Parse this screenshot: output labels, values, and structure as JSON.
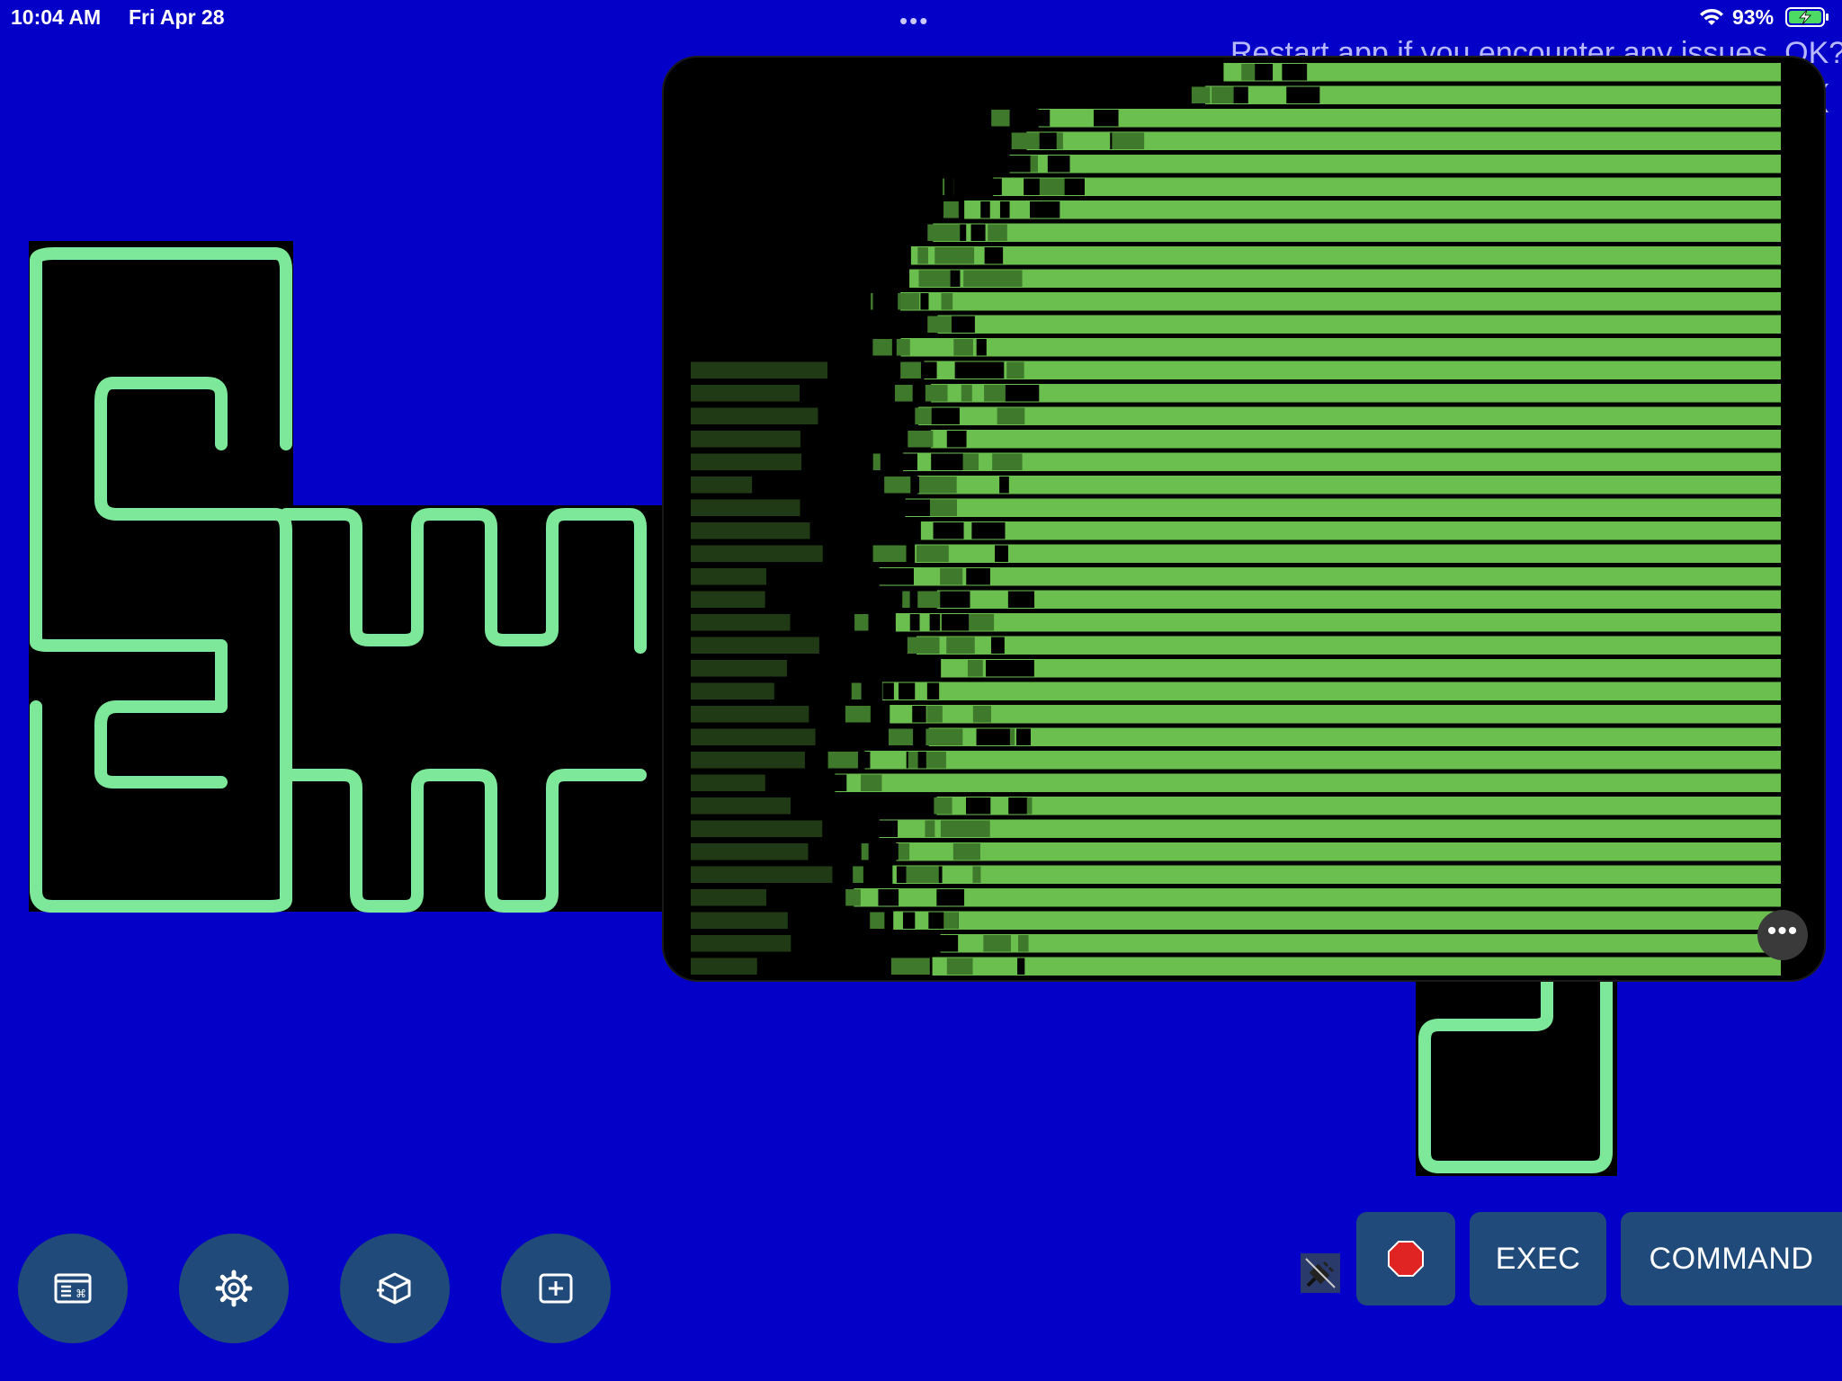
{
  "status_bar": {
    "time": "10:04 AM",
    "date": "Fri Apr 28",
    "multitask_dots": "•••",
    "battery_percent": "93%",
    "wifi_icon": "wifi-icon",
    "battery_icon": "battery-charging-icon"
  },
  "background": {
    "notice_line": "Restart app if you encounter any issues. OK?",
    "second_line": "(",
    "logo_color": "#7ee89a",
    "background_color": "#0500c8"
  },
  "pip_window": {
    "content": "terminal-ascii-art",
    "terminal_color": "#6bbf4e",
    "more_label": "•••"
  },
  "toolbar": {
    "buttons": [
      {
        "icon": "keyboard-window-icon"
      },
      {
        "icon": "gear-icon"
      },
      {
        "icon": "cube-icon"
      },
      {
        "icon": "add-square-icon"
      }
    ],
    "disconnect_icon": "plug-disconnected-icon",
    "stop_icon": "stop-sign-icon",
    "exec_label": "EXEC",
    "command_label": "COMMAND"
  }
}
